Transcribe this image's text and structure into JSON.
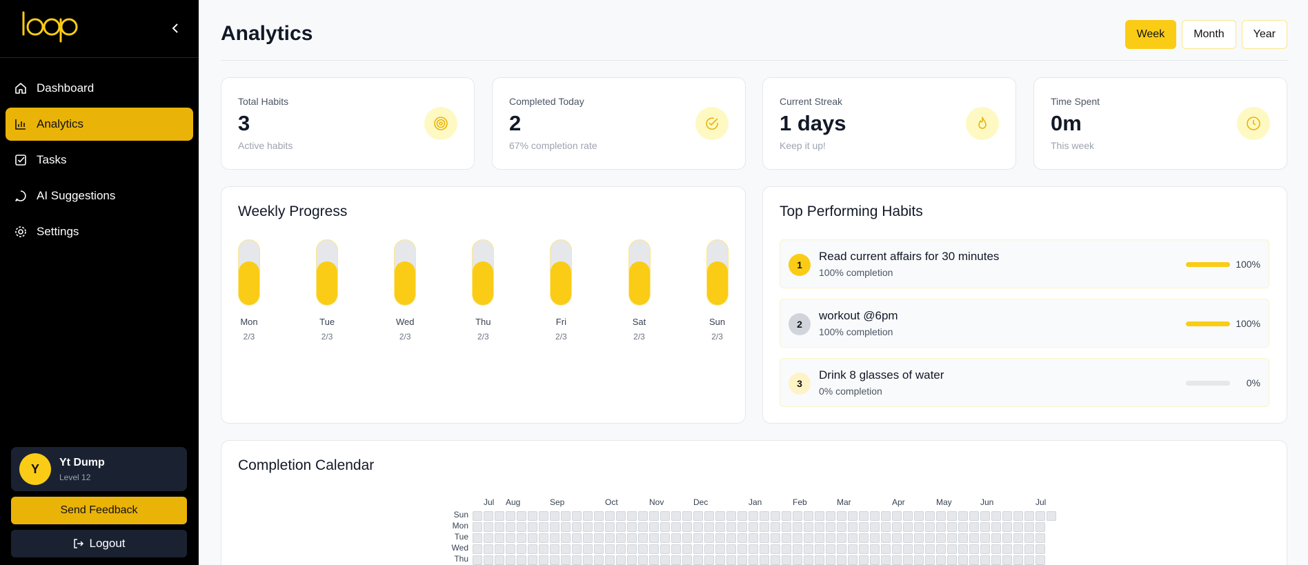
{
  "app": {
    "brand": "loop"
  },
  "sidebar": {
    "items": [
      {
        "label": "Dashboard",
        "icon": "home-icon",
        "active": false
      },
      {
        "label": "Analytics",
        "icon": "bar-chart-icon",
        "active": true
      },
      {
        "label": "Tasks",
        "icon": "checkbox-icon",
        "active": false
      },
      {
        "label": "AI Suggestions",
        "icon": "chat-icon",
        "active": false
      },
      {
        "label": "Settings",
        "icon": "gear-icon",
        "active": false
      }
    ],
    "user": {
      "initial": "Y",
      "name": "Yt Dump",
      "level": "Level 12"
    },
    "feedback_label": "Send Feedback",
    "logout_label": "Logout"
  },
  "header": {
    "title": "Analytics",
    "ranges": [
      {
        "label": "Week",
        "active": true
      },
      {
        "label": "Month",
        "active": false
      },
      {
        "label": "Year",
        "active": false
      }
    ]
  },
  "stats": [
    {
      "label": "Total Habits",
      "value": "3",
      "sub": "Active habits",
      "icon": "target-icon"
    },
    {
      "label": "Completed Today",
      "value": "2",
      "sub": "67% completion rate",
      "icon": "check-circle-icon"
    },
    {
      "label": "Current Streak",
      "value": "1 days",
      "sub": "Keep it up!",
      "icon": "flame-icon"
    },
    {
      "label": "Time Spent",
      "value": "0m",
      "sub": "This week",
      "icon": "clock-icon"
    }
  ],
  "weekly": {
    "title": "Weekly Progress",
    "days": [
      {
        "name": "Mon",
        "count": "2/3",
        "fraction": 0.67
      },
      {
        "name": "Tue",
        "count": "2/3",
        "fraction": 0.67
      },
      {
        "name": "Wed",
        "count": "2/3",
        "fraction": 0.67
      },
      {
        "name": "Thu",
        "count": "2/3",
        "fraction": 0.67
      },
      {
        "name": "Fri",
        "count": "2/3",
        "fraction": 0.67
      },
      {
        "name": "Sat",
        "count": "2/3",
        "fraction": 0.67
      },
      {
        "name": "Sun",
        "count": "2/3",
        "fraction": 0.67
      }
    ]
  },
  "top_habits": {
    "title": "Top Performing Habits",
    "items": [
      {
        "rank": "1",
        "name": "Read current affairs for 30 minutes",
        "sub": "100% completion",
        "percent": "100%",
        "fraction": 1.0,
        "rank_color": "#facc15"
      },
      {
        "rank": "2",
        "name": "workout @6pm",
        "sub": "100% completion",
        "percent": "100%",
        "fraction": 1.0,
        "rank_color": "#d1d5db"
      },
      {
        "rank": "3",
        "name": "Drink 8 glasses of water",
        "sub": "0% completion",
        "percent": "0%",
        "fraction": 0.0,
        "rank_color": "#fef3c7"
      }
    ]
  },
  "calendar": {
    "title": "Completion Calendar",
    "months": [
      "Jul",
      "Aug",
      "Sep",
      "Oct",
      "Nov",
      "Dec",
      "Jan",
      "Feb",
      "Mar",
      "Apr",
      "May",
      "Jun",
      "Jul"
    ],
    "day_labels": [
      "Sun",
      "Mon",
      "Tue",
      "Wed",
      "Thu"
    ]
  },
  "colors": {
    "accent": "#facc15",
    "accent_dark": "#eab308",
    "sidebar_bg": "#000000"
  }
}
